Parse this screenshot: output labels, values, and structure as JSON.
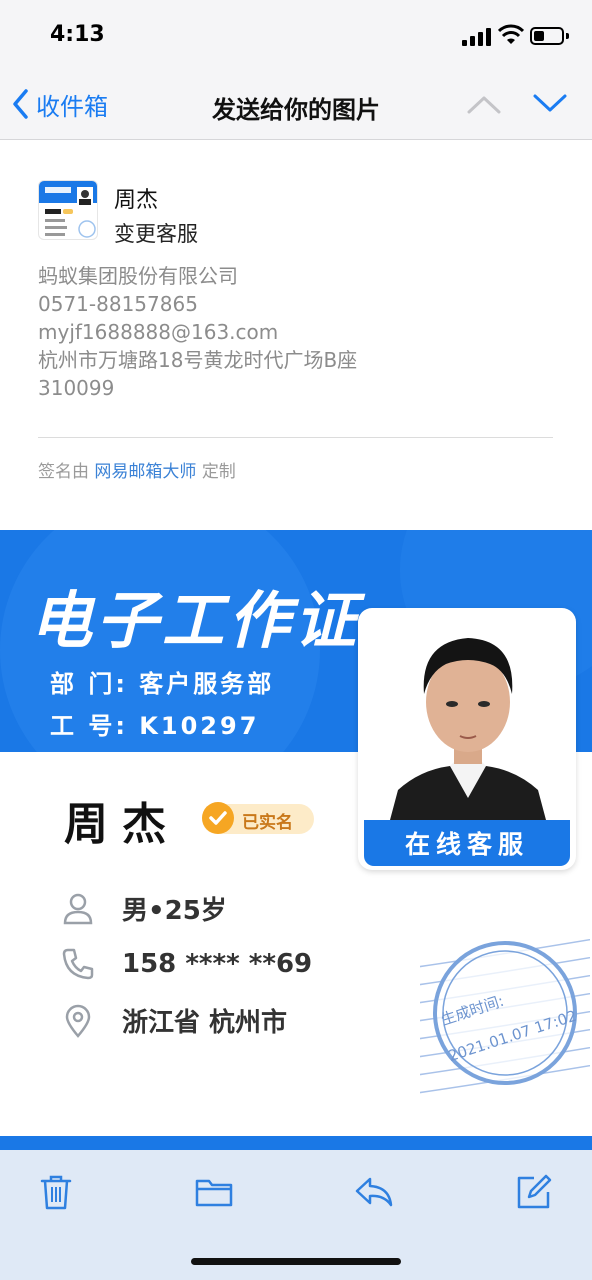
{
  "status_bar": {
    "time": "4:13"
  },
  "nav": {
    "back_label": "收件箱",
    "title": "发送给你的图片"
  },
  "sender": {
    "name": "周杰",
    "subject": "变更客服"
  },
  "signature": {
    "company": "蚂蚁集团股份有限公司",
    "phone": "0571-88157865",
    "email": "myjf1688888@163.com",
    "address": "杭州市万塘路18号黄龙时代广场B座",
    "postcode": "310099",
    "footer_prefix": "签名由",
    "footer_link": "网易邮箱大师",
    "footer_suffix": "定制"
  },
  "id_card": {
    "title": "电子工作证",
    "department": "部 门: 客户服务部",
    "employee_no": "工 号: K10297",
    "photo_caption": "在线客服",
    "name": "周杰",
    "verified_label": "已实名",
    "gender_age": "男•25岁",
    "phone_masked": "158 **** **69",
    "location": "浙江省 杭州市",
    "stamp_label": "生成时间:",
    "stamp_date": "2021.01.07 17:02",
    "brand_color": "#1a78e6"
  },
  "toolbar": {
    "icons": [
      "trash-icon",
      "folder-icon",
      "reply-icon",
      "compose-icon"
    ]
  },
  "colors": {
    "accent": "#1a7cf2",
    "toolbar_bg": "#dfe9f6"
  }
}
